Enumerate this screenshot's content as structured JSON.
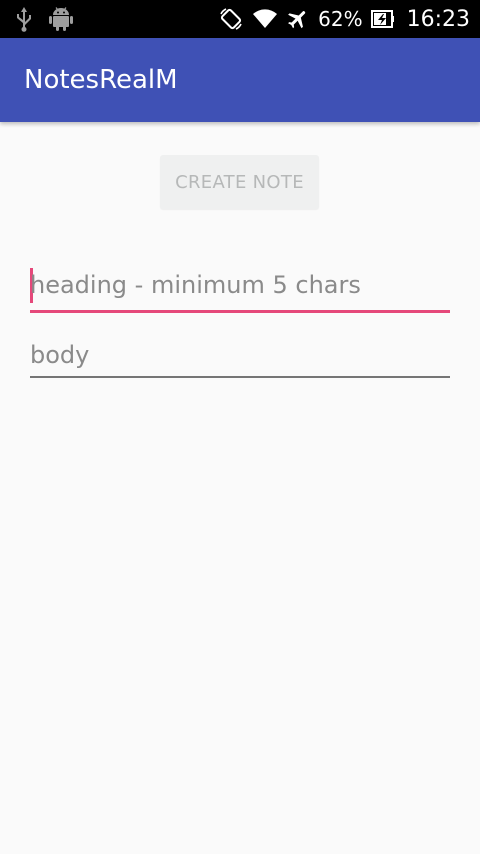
{
  "status_bar": {
    "battery_percent": "62%",
    "time": "16:23",
    "icons": [
      "usb-icon",
      "android-debug-icon",
      "auto-rotate-icon",
      "wifi-icon",
      "airplane-mode-icon",
      "battery-charging-icon"
    ]
  },
  "app_bar": {
    "title": "NotesRealM",
    "color": "#3f51b5"
  },
  "form": {
    "create_button_label": "CREATE NOTE",
    "heading_placeholder": "heading - minimum 5 chars",
    "heading_value": "",
    "body_placeholder": "body",
    "body_value": "",
    "accent_color": "#e5487a"
  }
}
